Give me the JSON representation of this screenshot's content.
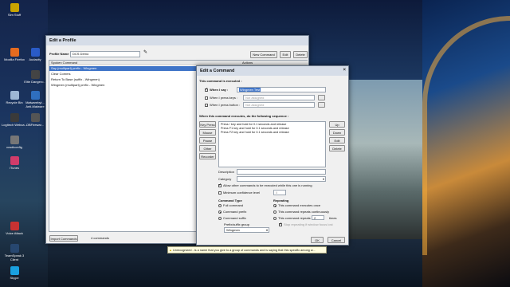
{
  "desktop": {
    "icons": [
      {
        "label": "Sim Stuff",
        "color": "#c9a400"
      },
      {
        "label": "Mozilla Firefox",
        "color": "#e56b1f"
      },
      {
        "label": "Audacity",
        "color": "#2a5bc7"
      },
      {
        "label": "Elite Dangero...",
        "color": "#444"
      },
      {
        "label": "Recycle Bin",
        "color": "#9db7d4"
      },
      {
        "label": "Malwarebyt... Anti-Malware",
        "color": "#2f6fbf"
      },
      {
        "label": "Logitech Webca...",
        "color": "#3a3a3a"
      },
      {
        "label": "OBFirewar...",
        "color": "#555"
      },
      {
        "label": "ccsdiconfig",
        "color": "#777"
      },
      {
        "label": "iTunes",
        "color": "#d23c6a"
      },
      {
        "label": "Voice Attack",
        "color": "#c83232"
      },
      {
        "label": "TeamSpeak 3 Client",
        "color": "#27476f"
      },
      {
        "label": "Skype",
        "color": "#1aa1e0"
      }
    ]
  },
  "profile_window": {
    "title": "Edit a Profile",
    "profile_name_label": "Profile Name :",
    "profile_name_value": "DCS Demo",
    "new_command": "New Command",
    "edit": "Edit",
    "delete": "Delete",
    "col_spoken": "Spoken Command",
    "col_actions": "Actions",
    "rows": [
      "Say (multipart) prefix - Wingmen",
      "Clear Comms",
      "Return To Base (suffix - Wingmen)",
      "Wingmen (multipart) prefix - Wingmen"
    ],
    "import_commands": "Import Commands",
    "count": "4 commands"
  },
  "command_window": {
    "title": "Edit a Command",
    "executed_label": "This command is executed :",
    "when_i_say": "When I say :",
    "when_i_say_value": "Wingmen Test",
    "when_keys": "When I press keys :",
    "when_keys_value": "Not assigned",
    "when_button": "When I press button :",
    "when_button_value": "Not assigned",
    "sequence_label": "When this command executes, do the following sequence :",
    "left_buttons": [
      "Key Press",
      "Mouse",
      "Pause",
      "Other",
      "Recorder"
    ],
    "sequence": [
      "Press / key and hold for 0.1 seconds and release",
      "Press F1 key and hold for 0.1 seconds and release",
      "Press F2 key and hold for 0.1 seconds and release"
    ],
    "right_buttons": [
      "Up",
      "Down",
      "Edit",
      "Delete"
    ],
    "description_label": "Description",
    "category_label": "Category",
    "allow_label": "Allow other commands to be executed while this one is running",
    "min_conf_label": "Minimum confidence level",
    "min_conf_value": "0",
    "command_type_label": "Command Type",
    "type_options": [
      "Full command",
      "Command prefix",
      "Command suffix"
    ],
    "prefix_group_label": "Prefix/suffix group",
    "prefix_group_value": "Wingmen",
    "repeating_label": "Repeating",
    "repeat_options": [
      "This command executes once",
      "This command repeats continuously",
      "This command repeats"
    ],
    "repeat_count": "2",
    "times": "times",
    "stop_label": "Stop repeating if window focus lost",
    "ok": "OK",
    "cancel": "Cancel"
  },
  "tooltip": "Unrecognized - is a name that you give to a group of commands and is saying that this specific among w..."
}
